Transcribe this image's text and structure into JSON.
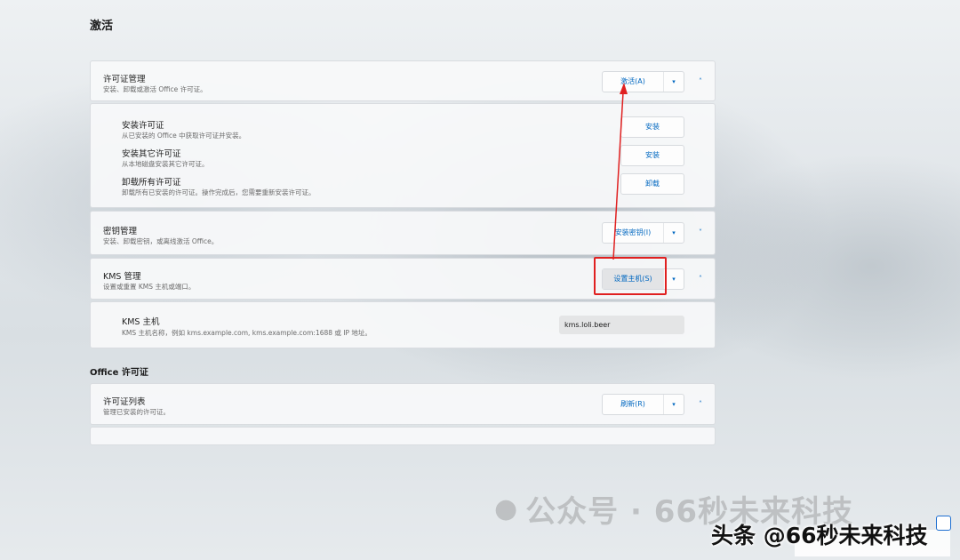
{
  "page": {
    "title": "激活"
  },
  "license_management": {
    "title": "许可证管理",
    "desc": "安装、卸载或激活 Office 许可证。",
    "activate_label": "激活(A)",
    "items": [
      {
        "title": "安装许可证",
        "desc": "从已安装的 Office 中获取许可证并安装。",
        "button": "安装"
      },
      {
        "title": "安装其它许可证",
        "desc": "从本地磁盘安装其它许可证。",
        "button": "安装"
      },
      {
        "title": "卸载所有许可证",
        "desc": "卸载所有已安装的许可证。操作完成后，您需要重新安装许可证。",
        "button": "卸载"
      }
    ]
  },
  "key_management": {
    "title": "密钥管理",
    "desc": "安装、卸载密钥，或离线激活 Office。",
    "install_key_label": "安装密钥(I)"
  },
  "kms_management": {
    "title": "KMS 管理",
    "desc": "设置或重置 KMS 主机或端口。",
    "set_host_label": "设置主机(S)",
    "host": {
      "title": "KMS 主机",
      "desc": "KMS 主机名称，例如 kms.example.com, kms.example.com:1688 或 IP 地址。",
      "value": "kms.loli.beer"
    }
  },
  "office_license_section": {
    "title": "Office 许可证",
    "list": {
      "title": "许可证列表",
      "desc": "管理已安装的许可证。",
      "refresh_label": "刷新(R)"
    }
  },
  "icons": {
    "dropdown": "chevron-down-icon",
    "collapse": "chevron-up-icon",
    "expand": "chevron-down-icon",
    "wechat": "wechat-icon"
  },
  "glyphs": {
    "dropdown": "▾",
    "up": "˄",
    "down": "˅"
  },
  "watermark": {
    "text": "公众号 · 66秒未来科技",
    "overlay_text": "头条 @66秒未来科技"
  },
  "colors": {
    "accent": "#0067c0",
    "highlight": "#e02020"
  }
}
